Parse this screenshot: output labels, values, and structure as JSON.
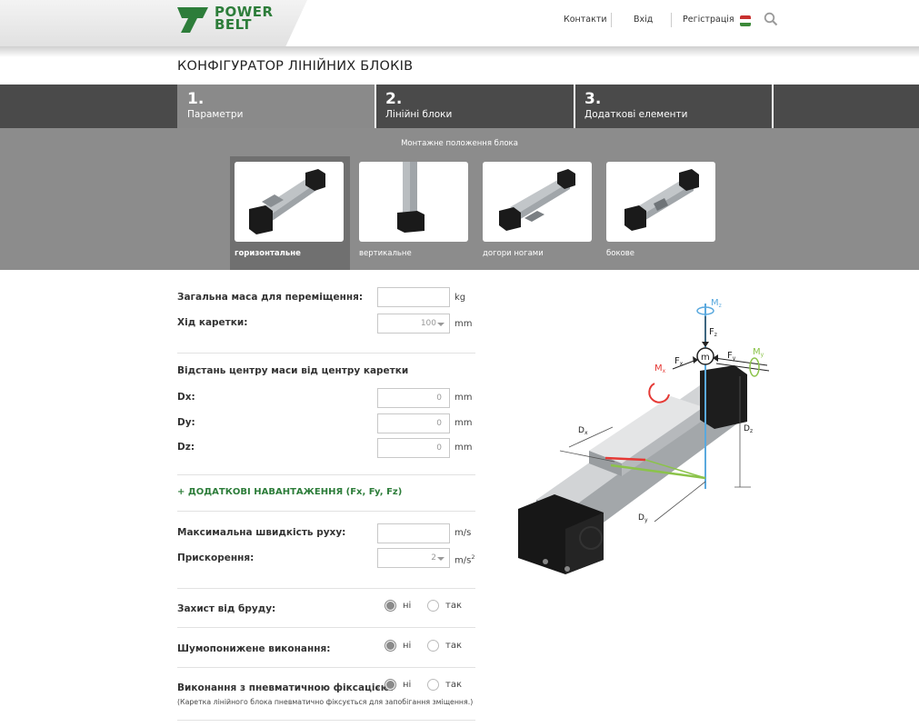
{
  "brand": {
    "line1": "POWER",
    "line2": "BELT"
  },
  "nav": {
    "contacts": "Контакти",
    "login": "Вхід",
    "register": "Регістрація"
  },
  "page_title": "КОНФІГУРАТОР ЛІНІЙНИХ БЛОКІВ",
  "steps": [
    {
      "num": "1.",
      "label": "Параметри"
    },
    {
      "num": "2.",
      "label": "Лінійні блоки"
    },
    {
      "num": "3.",
      "label": "Додаткові елементи"
    }
  ],
  "mounting": {
    "title": "Монтажне положення блока",
    "options": [
      "горизонтальне",
      "вертикальне",
      "догори ногами",
      "бокове"
    ],
    "selected": "горизонтальне"
  },
  "form": {
    "total_mass": {
      "label": "Загальна маса для переміщення:",
      "value": "",
      "unit": "kg"
    },
    "stroke": {
      "label": "Хід каретки:",
      "value": "100",
      "unit": "mm"
    },
    "offset_heading": "Відстань центру маси від центру каретки",
    "dx": {
      "label": "Dx:",
      "value": "0",
      "unit": "mm"
    },
    "dy": {
      "label": "Dy:",
      "value": "0",
      "unit": "mm"
    },
    "dz": {
      "label": "Dz:",
      "value": "0",
      "unit": "mm"
    },
    "additional_loads": "+ ДОДАТКОВІ НАВАНТАЖЕННЯ (Fx, Fy, Fz)",
    "max_speed": {
      "label": "Максимальна швидкість руху:",
      "value": "",
      "unit": "m/s"
    },
    "acceleration": {
      "label": "Прискорення:",
      "value": "2",
      "unit": "m/s"
    },
    "dirt_protection": {
      "label": "Захист від бруду:",
      "no": "ні",
      "yes": "так",
      "selected": "ні"
    },
    "low_noise": {
      "label": "Шумопонижене виконання:",
      "no": "ні",
      "yes": "так",
      "selected": "ні"
    },
    "pneumatic": {
      "label": "Виконання з пневматичною фіксацією:",
      "no": "ні",
      "yes": "так",
      "selected": "ні",
      "note": "(Каретка лінійного блока пневматично фіксується для запобігання зміщення.)"
    }
  },
  "diagram_labels": {
    "mz": "M",
    "mz_sub": "z",
    "fz": "F",
    "fz_sub": "z",
    "m": "m",
    "fx": "F",
    "fx_sub": "x",
    "fy": "F",
    "fy_sub": "y",
    "mx": "M",
    "mx_sub": "x",
    "my": "M",
    "my_sub": "y",
    "dx": "D",
    "dx_sub": "x",
    "dy": "D",
    "dy_sub": "y",
    "dz": "D",
    "dz_sub": "z"
  },
  "colors": {
    "brand_green": "#2d7d3a",
    "step_bar": "#4a4a4a",
    "panel_grey": "#8c8c8c"
  }
}
